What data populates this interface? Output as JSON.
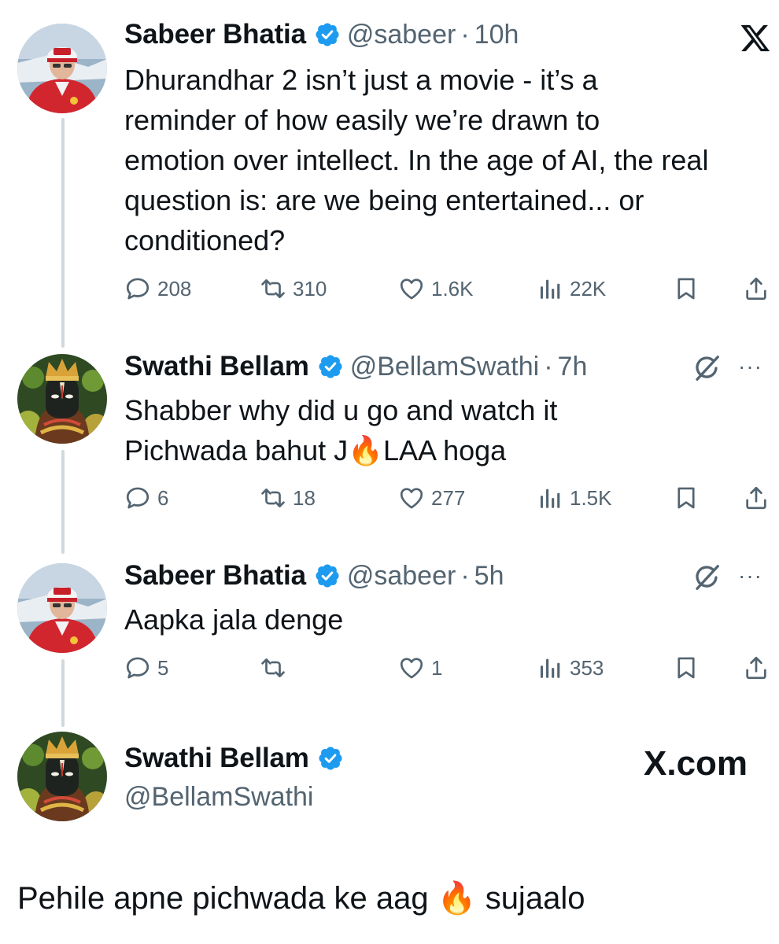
{
  "tweets": [
    {
      "name": "Sabeer Bhatia",
      "handle": "@sabeer",
      "time": "10h",
      "lines": [
        "Dhurandhar 2 isn’t just a movie - it’s a",
        "reminder of how easily we’re drawn to",
        "emotion over intellect. In the age of AI, the real",
        "question is: are we being entertained... or",
        "conditioned?"
      ],
      "replies": "208",
      "reposts": "310",
      "likes": "1.6K",
      "views": "22K"
    },
    {
      "name": "Swathi Bellam",
      "handle": "@BellamSwathi",
      "time": "7h",
      "line1": "Shabber why did u go and watch it",
      "line2_a": "Pichwada bahut J",
      "line2_emoji": "🔥",
      "line2_b": "LAA hoga",
      "replies": "6",
      "reposts": "18",
      "likes": "277",
      "views": "1.5K"
    },
    {
      "name": "Sabeer Bhatia",
      "handle": "@sabeer",
      "time": "5h",
      "line1": "Aapka jala denge",
      "replies": "5",
      "reposts": "",
      "likes": "1",
      "views": "353"
    }
  ],
  "card": {
    "name": "Swathi Bellam",
    "handle": "@BellamSwathi",
    "brand": "X.com"
  },
  "caption": {
    "before": "Pehile apne pichwada ke aag",
    "emoji": "🔥",
    "after": "sujaalo"
  },
  "separator": "·",
  "more_label": "···",
  "icons": [
    "x-logo-icon",
    "verified-badge-icon",
    "reply-icon",
    "repost-icon",
    "like-icon",
    "views-icon",
    "bookmark-icon",
    "share-icon",
    "grok-icon",
    "more-icon"
  ],
  "colors": {
    "text": "#0f1419",
    "muted": "#536471",
    "verified": "#1d9bf0",
    "thread_line": "#cfd9de"
  }
}
